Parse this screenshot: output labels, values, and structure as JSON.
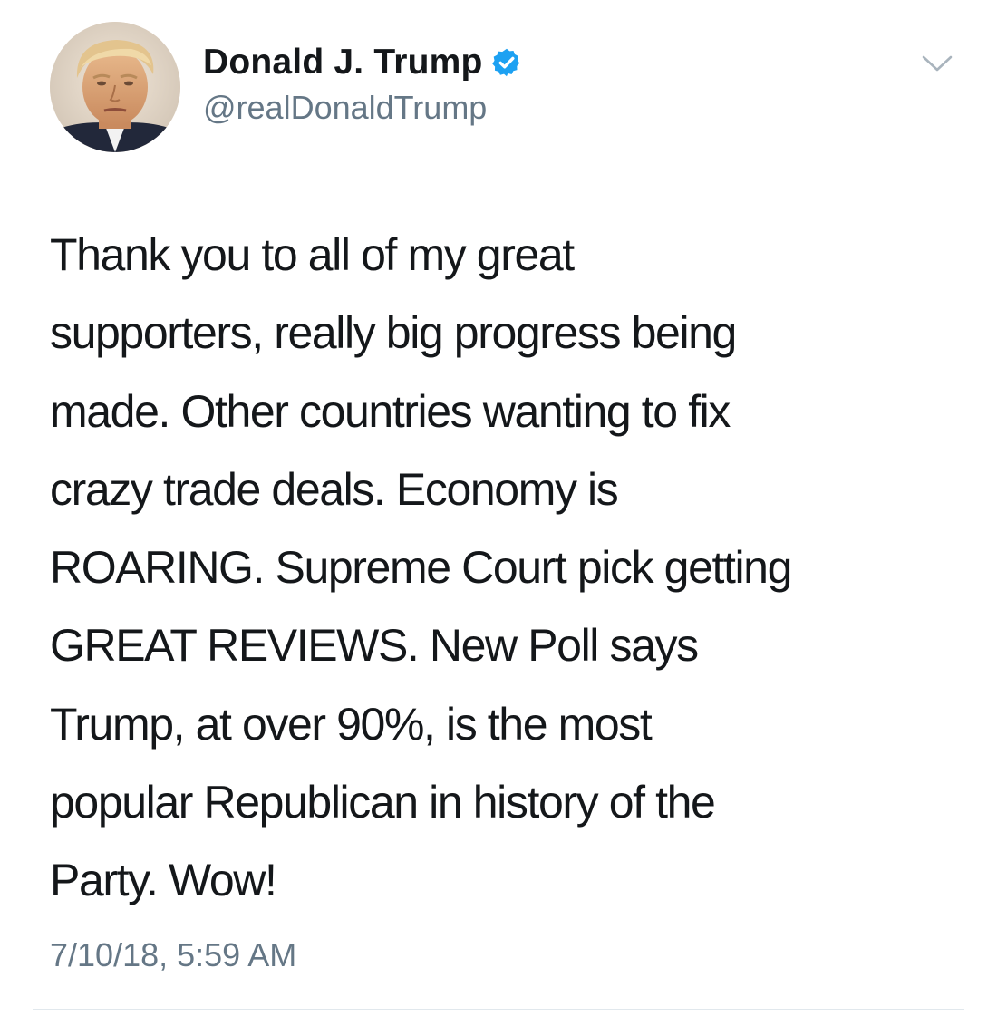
{
  "tweet": {
    "author": {
      "display_name": "Donald J. Trump",
      "handle": "@realDonaldTrump",
      "verified": true,
      "avatar": "profile-photo"
    },
    "text": "Thank you to all of my great\nsupporters, really big progress being\nmade. Other countries wanting to fix\ncrazy trade deals. Economy is\nROARING. Supreme Court pick getting\nGREAT REVIEWS. New Poll says\nTrump, at over 90%, is the most\npopular Republican in history of the\nParty. Wow!",
    "timestamp": "7/10/18, 5:59 AM",
    "menu_icon": "chevron-down-icon"
  },
  "colors": {
    "text_primary": "#14171a",
    "text_secondary": "#657786",
    "verified_blue": "#1da1f2",
    "divider": "#e1e8ed",
    "background": "#ffffff"
  }
}
